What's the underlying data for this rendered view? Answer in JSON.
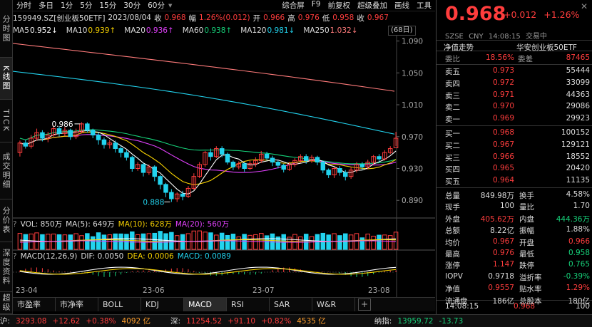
{
  "left_tabs": [
    {
      "name": "tab-intraday",
      "label": "分时图"
    },
    {
      "name": "tab-kline",
      "label": "K线图",
      "active": true
    },
    {
      "name": "tab-tick",
      "label": "TICK"
    },
    {
      "name": "tab-trades",
      "label": "成交明细"
    },
    {
      "name": "tab-price-dist",
      "label": "分价表"
    },
    {
      "name": "tab-depth",
      "label": "深度资料"
    },
    {
      "name": "tab-overview",
      "label": "超级"
    }
  ],
  "toolbar": {
    "periods": [
      "分时",
      "多日",
      "1分",
      "5分",
      "15分",
      "30分",
      "60分"
    ],
    "tools": [
      "综合屏",
      "F9",
      "前复权",
      "超级叠加",
      "画线",
      "工具"
    ]
  },
  "quote": {
    "code": "159949.SZ[创业板50ETF]",
    "date": "2023/08/04",
    "close_label": "收",
    "close": "0.968",
    "amp_label": "幅",
    "amp": "1.26%(0.012)",
    "open_label": "开",
    "open": "0.966",
    "high_label": "高",
    "high": "0.976",
    "low_label": "低",
    "low": "0.958",
    "close2_label": "收",
    "close2": "0.967"
  },
  "ma": [
    {
      "name": "MA5",
      "value": "0.952↓",
      "color": "#ffffff"
    },
    {
      "name": "MA10",
      "value": "0.939↑",
      "color": "#f5d000"
    },
    {
      "name": "MA20",
      "value": "0.936↑",
      "color": "#e040fb"
    },
    {
      "name": "MA60",
      "value": "0.938↑",
      "color": "#16d27a"
    },
    {
      "name": "MA120",
      "value": "0.981↓",
      "color": "#22d3ee"
    },
    {
      "name": "MA250",
      "value": "1.032↓",
      "color": "#ff7b7b"
    }
  ],
  "day_range": "(68日)",
  "y_axis": [
    "1.090",
    "1.050",
    "1.010",
    "0.970",
    "0.930",
    "0.890"
  ],
  "x_axis": [
    "23-04",
    "23-06",
    "23-07",
    "23-08"
  ],
  "annotations": {
    "high": "0.986",
    "low": "0.888"
  },
  "vol": {
    "label": "VOL: 850万",
    "ma5": "MA(5): 649万",
    "ma10": "MA(10): 628万",
    "ma20": "MA(20): 560万"
  },
  "macd": {
    "label": "MACD(12,26,9)",
    "dif": "DIF: 0.0050",
    "dea": "DEA: 0.0006",
    "macd": "MACD: 0.0089"
  },
  "indicator_tabs": [
    "市盈率",
    "市净率",
    "BOLL",
    "KDJ",
    "MACD",
    "RSI",
    "SAR",
    "W&R"
  ],
  "indicator_active": "MACD",
  "status": {
    "sh_label": "沪:",
    "sh_index": "3293.08",
    "sh_chg": "+12.62",
    "sh_pct": "+0.38%",
    "sh_amt": "4092 亿",
    "sz_label": "深:",
    "sz_index": "11254.52",
    "sz_chg": "+91.10",
    "sz_pct": "+0.82%",
    "sz_amt": "4535 亿",
    "nas_label": "纳指:",
    "nas_index": "13959.72",
    "nas_chg": "-13.73"
  },
  "right": {
    "price": "0.968",
    "chg": "+0.012",
    "pct": "+1.26%",
    "exchange": "SZSE",
    "currency": "CNY",
    "time": "14:08:15",
    "status": "交易中",
    "title_left": "净值走势",
    "title_right": "华安创业板50ETF",
    "weibi_label": "委比",
    "weibi": "18.56%",
    "weicha_label": "委差",
    "weicha": "87465",
    "asks": [
      {
        "label": "卖五",
        "price": "0.973",
        "vol": "55444"
      },
      {
        "label": "卖四",
        "price": "0.972",
        "vol": "33099"
      },
      {
        "label": "卖三",
        "price": "0.971",
        "vol": "44363"
      },
      {
        "label": "卖二",
        "price": "0.970",
        "vol": "29086"
      },
      {
        "label": "卖一",
        "price": "0.969",
        "vol": "29923"
      }
    ],
    "bids": [
      {
        "label": "买一",
        "price": "0.968",
        "vol": "100152"
      },
      {
        "label": "买二",
        "price": "0.967",
        "vol": "129121"
      },
      {
        "label": "买三",
        "price": "0.966",
        "vol": "18552"
      },
      {
        "label": "买四",
        "price": "0.965",
        "vol": "20420"
      },
      {
        "label": "买五",
        "price": "0.964",
        "vol": "11135"
      }
    ],
    "stats": [
      {
        "l1": "总量",
        "v1": "849.98万",
        "c1": "white",
        "l2": "换手",
        "v2": "4.58%",
        "c2": "white"
      },
      {
        "l1": "现手",
        "v1": "100",
        "c1": "white",
        "l2": "量比",
        "v2": "1.70",
        "c2": "white"
      },
      {
        "l1": "外盘",
        "v1": "405.62万",
        "c1": "red",
        "l2": "内盘",
        "v2": "444.36万",
        "c2": "green"
      },
      {
        "l1": "总额",
        "v1": "8.22亿",
        "c1": "white",
        "l2": "振幅",
        "v2": "1.88%",
        "c2": "white"
      },
      {
        "l1": "均价",
        "v1": "0.967",
        "c1": "red",
        "l2": "开盘",
        "v2": "0.966",
        "c2": "red"
      },
      {
        "l1": "最高",
        "v1": "0.976",
        "c1": "red",
        "l2": "最低",
        "v2": "0.958",
        "c2": "green"
      },
      {
        "l1": "涨停",
        "v1": "1.147",
        "c1": "red",
        "l2": "跌停",
        "v2": "0.765",
        "c2": "green"
      },
      {
        "l1": "IOPV",
        "v1": "0.9718",
        "c1": "white",
        "l2": "溢折率",
        "v2": "-0.39%",
        "c2": "green"
      },
      {
        "l1": "净值",
        "v1": "0.9557",
        "c1": "red",
        "l2": "贴水率",
        "v2": "1.29%",
        "c2": "red"
      },
      {
        "l1": "流通盘",
        "v1": "186亿",
        "c1": "white",
        "l2": "总股本",
        "v2": "180亿",
        "c2": "white"
      }
    ],
    "last_trade": {
      "time": "14:08:15",
      "price": "0.968",
      "vol": "100"
    }
  },
  "chart_data": {
    "type": "candlestick",
    "y_range": [
      0.875,
      1.095
    ],
    "candles": [
      [
        0.95,
        0.962,
        0.945,
        0.965
      ],
      [
        0.962,
        0.958,
        0.955,
        0.966
      ],
      [
        0.958,
        0.968,
        0.955,
        0.972
      ],
      [
        0.968,
        0.975,
        0.965,
        0.98
      ],
      [
        0.975,
        0.968,
        0.964,
        0.978
      ],
      [
        0.968,
        0.972,
        0.963,
        0.976
      ],
      [
        0.972,
        0.98,
        0.97,
        0.984
      ],
      [
        0.98,
        0.974,
        0.97,
        0.983
      ],
      [
        0.974,
        0.978,
        0.971,
        0.982
      ],
      [
        0.978,
        0.97,
        0.966,
        0.98
      ],
      [
        0.97,
        0.976,
        0.967,
        0.98
      ],
      [
        0.976,
        0.986,
        0.974,
        0.988
      ],
      [
        0.986,
        0.978,
        0.975,
        0.988
      ],
      [
        0.978,
        0.972,
        0.968,
        0.98
      ],
      [
        0.972,
        0.966,
        0.96,
        0.975
      ],
      [
        0.966,
        0.96,
        0.955,
        0.969
      ],
      [
        0.96,
        0.962,
        0.955,
        0.966
      ],
      [
        0.962,
        0.955,
        0.95,
        0.965
      ],
      [
        0.955,
        0.95,
        0.944,
        0.958
      ],
      [
        0.95,
        0.944,
        0.94,
        0.953
      ],
      [
        0.944,
        0.93,
        0.926,
        0.946
      ],
      [
        0.93,
        0.935,
        0.927,
        0.938
      ],
      [
        0.935,
        0.925,
        0.92,
        0.937
      ],
      [
        0.925,
        0.932,
        0.922,
        0.935
      ],
      [
        0.932,
        0.92,
        0.914,
        0.934
      ],
      [
        0.92,
        0.91,
        0.904,
        0.922
      ],
      [
        0.91,
        0.9,
        0.894,
        0.912
      ],
      [
        0.9,
        0.892,
        0.888,
        0.904
      ],
      [
        0.892,
        0.898,
        0.888,
        0.9
      ],
      [
        0.898,
        0.895,
        0.89,
        0.902
      ],
      [
        0.895,
        0.905,
        0.893,
        0.908
      ],
      [
        0.905,
        0.92,
        0.903,
        0.924
      ],
      [
        0.92,
        0.935,
        0.918,
        0.938
      ],
      [
        0.935,
        0.95,
        0.932,
        0.952
      ],
      [
        0.95,
        0.945,
        0.94,
        0.955
      ],
      [
        0.945,
        0.955,
        0.943,
        0.958
      ],
      [
        0.955,
        0.948,
        0.944,
        0.958
      ],
      [
        0.948,
        0.938,
        0.935,
        0.95
      ],
      [
        0.938,
        0.932,
        0.928,
        0.94
      ],
      [
        0.932,
        0.936,
        0.929,
        0.939
      ],
      [
        0.936,
        0.93,
        0.926,
        0.938
      ],
      [
        0.93,
        0.936,
        0.928,
        0.94
      ],
      [
        0.936,
        0.94,
        0.932,
        0.944
      ],
      [
        0.94,
        0.948,
        0.937,
        0.952
      ],
      [
        0.948,
        0.943,
        0.94,
        0.951
      ],
      [
        0.943,
        0.938,
        0.933,
        0.946
      ],
      [
        0.938,
        0.934,
        0.93,
        0.94
      ],
      [
        0.934,
        0.929,
        0.925,
        0.936
      ],
      [
        0.929,
        0.935,
        0.927,
        0.938
      ],
      [
        0.935,
        0.94,
        0.932,
        0.943
      ],
      [
        0.94,
        0.945,
        0.937,
        0.948
      ],
      [
        0.945,
        0.94,
        0.936,
        0.948
      ],
      [
        0.94,
        0.944,
        0.937,
        0.947
      ],
      [
        0.944,
        0.938,
        0.934,
        0.946
      ],
      [
        0.938,
        0.928,
        0.924,
        0.94
      ],
      [
        0.928,
        0.922,
        0.918,
        0.93
      ],
      [
        0.922,
        0.93,
        0.918,
        0.932
      ],
      [
        0.93,
        0.925,
        0.921,
        0.933
      ],
      [
        0.925,
        0.92,
        0.915,
        0.928
      ],
      [
        0.92,
        0.928,
        0.917,
        0.932
      ],
      [
        0.928,
        0.935,
        0.925,
        0.938
      ],
      [
        0.935,
        0.932,
        0.928,
        0.938
      ],
      [
        0.932,
        0.938,
        0.929,
        0.941
      ],
      [
        0.938,
        0.945,
        0.935,
        0.947
      ],
      [
        0.945,
        0.942,
        0.938,
        0.948
      ],
      [
        0.942,
        0.95,
        0.94,
        0.953
      ],
      [
        0.95,
        0.955,
        0.948,
        0.958
      ],
      [
        0.956,
        0.968,
        0.958,
        0.976
      ]
    ]
  }
}
